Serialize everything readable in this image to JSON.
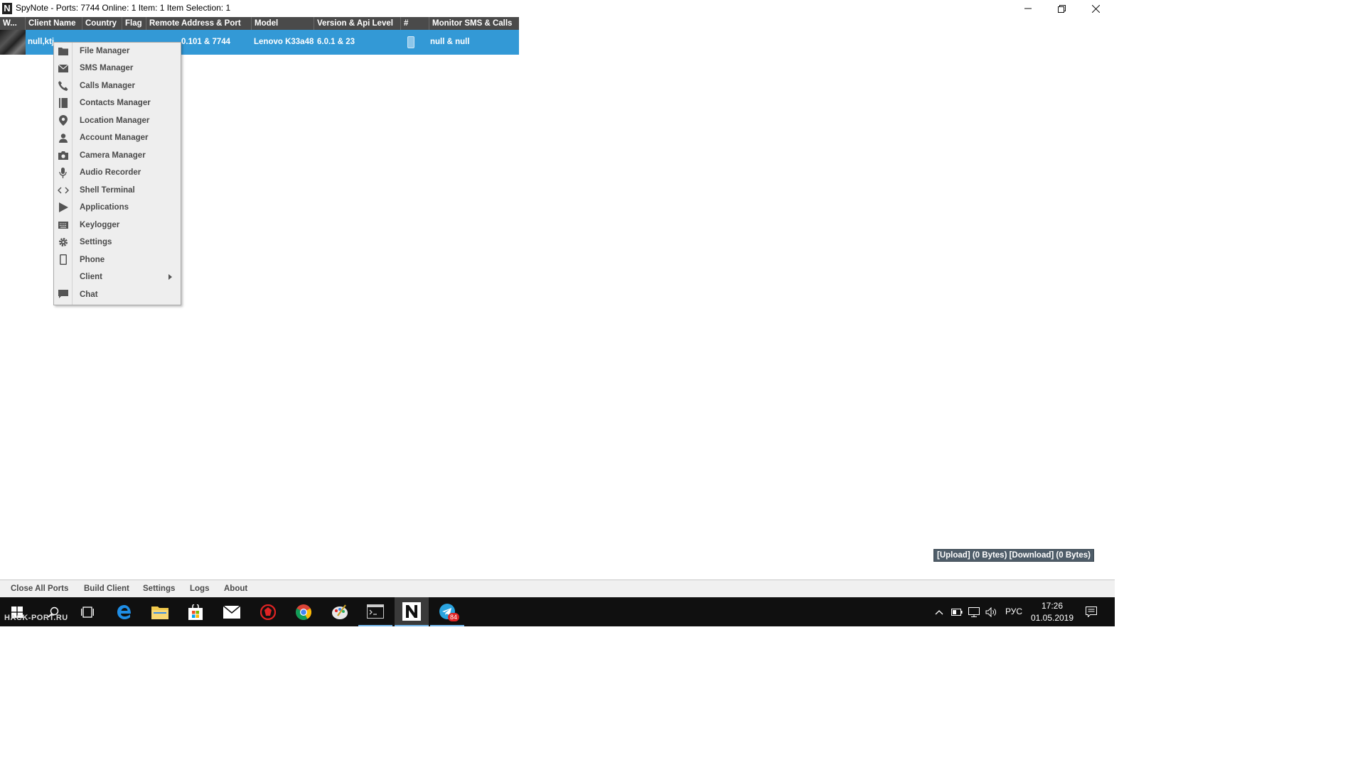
{
  "window": {
    "title": "SpyNote - Ports: 7744 Online: 1 Item: 1 Item Selection: 1",
    "app_icon_letter": "N"
  },
  "table": {
    "columns": [
      "W...",
      "Client Name",
      "Country",
      "Flag",
      "Remote Address & Port",
      "Model",
      "Version & Api Level",
      "#",
      "Monitor SMS & Calls"
    ],
    "rows": [
      {
        "client_name": "null,ktj",
        "remote_address": "0.101 & 7744",
        "model": "Lenovo K33a48",
        "version": "6.0.1 & 23",
        "monitor": "null & null"
      }
    ]
  },
  "context_menu": {
    "items": [
      {
        "label": "File Manager",
        "icon": "folder-icon"
      },
      {
        "label": "SMS Manager",
        "icon": "envelope-icon"
      },
      {
        "label": "Calls Manager",
        "icon": "phone-handset-icon"
      },
      {
        "label": "Contacts Manager",
        "icon": "contacts-book-icon"
      },
      {
        "label": "Location Manager",
        "icon": "map-pin-icon"
      },
      {
        "label": "Account Manager",
        "icon": "user-icon"
      },
      {
        "label": "Camera Manager",
        "icon": "camera-icon"
      },
      {
        "label": "Audio Recorder",
        "icon": "microphone-icon"
      },
      {
        "label": "Shell Terminal",
        "icon": "code-brackets-icon"
      },
      {
        "label": "Applications",
        "icon": "play-store-icon"
      },
      {
        "label": "Keylogger",
        "icon": "keyboard-icon"
      },
      {
        "label": "Settings",
        "icon": "gear-icon"
      },
      {
        "label": "Phone",
        "icon": "smartphone-icon"
      },
      {
        "label": "Client",
        "icon": "",
        "submenu": true
      },
      {
        "label": "Chat",
        "icon": "chat-bubble-icon"
      }
    ]
  },
  "transfer_status": "[Upload] (0 Bytes) [Download] (0 Bytes)",
  "bottom_menu": [
    "Close All Ports",
    "Build Client",
    "Settings",
    "Logs",
    "About"
  ],
  "taskbar": {
    "watermark": "HACK-PORT.RU",
    "language": "РУС",
    "time": "17:26",
    "date": "01.05.2019",
    "telegram_badge": "84",
    "accent": "#76b9ed"
  },
  "colors": {
    "selection": "#3399d6",
    "header": "#4a4a4a",
    "transfer_bg": "#4f5d69"
  }
}
